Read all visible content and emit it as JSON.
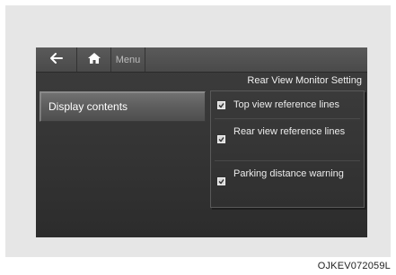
{
  "topbar": {
    "back_icon": "back-arrow-icon",
    "home_icon": "home-icon",
    "menu_label": "Menu"
  },
  "screen_title": "Rear View Monitor Setting",
  "left_menu": {
    "items": [
      {
        "label": "Display contents",
        "selected": true
      }
    ]
  },
  "options": [
    {
      "label": "Top view reference lines",
      "checked": true
    },
    {
      "label": "Rear view reference lines",
      "checked": true
    },
    {
      "label": "Parking distance warning",
      "checked": true
    }
  ],
  "figure_code": "OJKEV072059L",
  "colors": {
    "screen_bg": "#343434",
    "topbar_bg": "#4f4f4f",
    "text": "#ececec"
  }
}
